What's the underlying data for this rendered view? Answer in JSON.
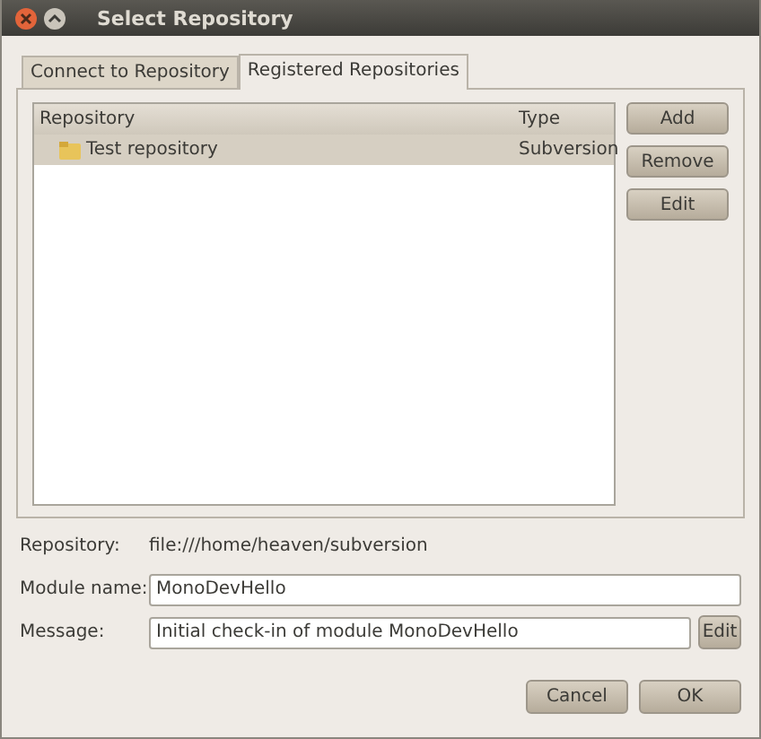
{
  "window": {
    "title": "Select Repository"
  },
  "tabs": [
    {
      "label": "Connect to Repository",
      "selected": false
    },
    {
      "label": "Registered Repositories",
      "selected": true
    }
  ],
  "table": {
    "columns": [
      "Repository",
      "Type"
    ],
    "rows": [
      {
        "name": "Test repository",
        "type": "Subversion",
        "selected": true
      }
    ]
  },
  "side_buttons": [
    "Add",
    "Remove",
    "Edit"
  ],
  "repository": {
    "label": "Repository:",
    "value": "file:///home/heaven/subversion"
  },
  "module_name": {
    "label": "Module name:",
    "value": "MonoDevHello"
  },
  "message": {
    "label": "Message:",
    "value": "Initial check-in of module MonoDevHello",
    "button": "Edit"
  },
  "buttons": [
    "Cancel",
    "OK"
  ]
}
